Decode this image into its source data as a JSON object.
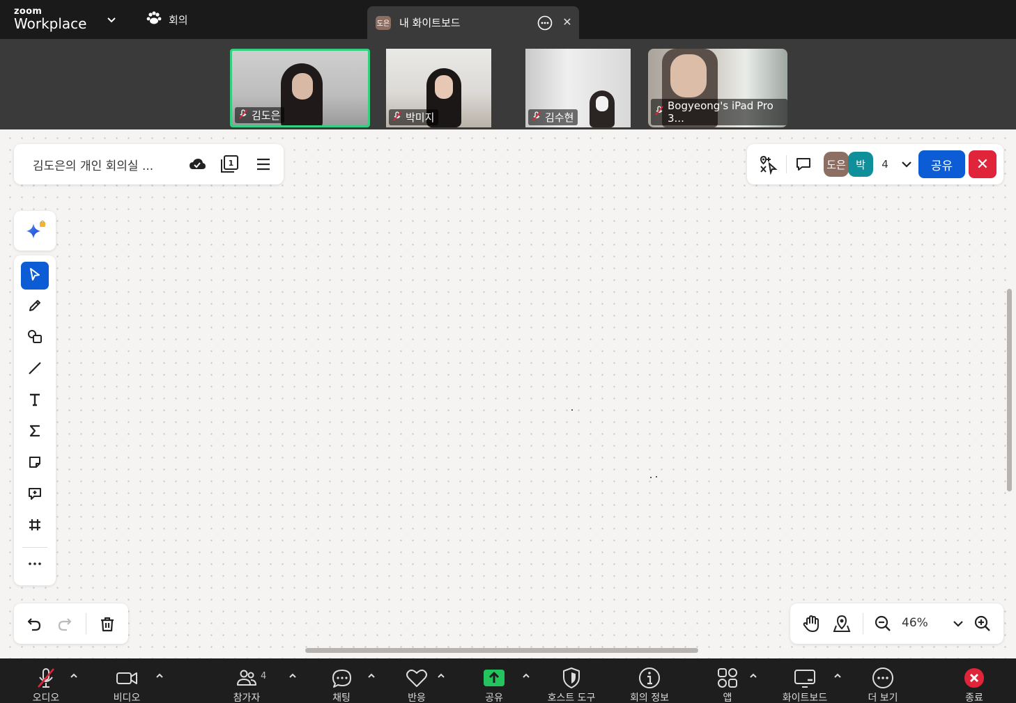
{
  "app": {
    "brand_small": "zoom",
    "brand_big": "Workplace",
    "meeting_tab_label": "회의"
  },
  "whiteboard_tab": {
    "avatar_text": "도은",
    "title": "내 화이트보드"
  },
  "participants": [
    {
      "name": "김도은",
      "muted": true,
      "active": true
    },
    {
      "name": "박미지",
      "muted": true,
      "active": false
    },
    {
      "name": "김수현",
      "muted": true,
      "active": false
    },
    {
      "name": "Bogyeong's iPad Pro 3...",
      "muted": true,
      "active": false
    }
  ],
  "board": {
    "title": "김도은의 개인 회의실 ...",
    "page_badge": "1",
    "collaborators": [
      {
        "initials": "도은",
        "color": "#8d6e63"
      },
      {
        "initials": "박",
        "color": "#0e8f9a"
      }
    ],
    "collaborator_count": "4",
    "share_label": "공유",
    "zoom_level": "46%"
  },
  "tools": [
    {
      "name": "select-tool",
      "icon": "cursor-icon"
    },
    {
      "name": "pen-tool",
      "icon": "pen-icon"
    },
    {
      "name": "shapes-tool",
      "icon": "shapes-icon"
    },
    {
      "name": "line-tool",
      "icon": "line-icon"
    },
    {
      "name": "text-tool",
      "icon": "text-icon"
    },
    {
      "name": "math-tool",
      "icon": "sigma-icon"
    },
    {
      "name": "sticky-note-tool",
      "icon": "sticky-note-icon"
    },
    {
      "name": "comment-tool",
      "icon": "comment-icon"
    },
    {
      "name": "frame-tool",
      "icon": "frame-icon"
    },
    {
      "name": "more-tools",
      "icon": "ellipsis-icon"
    }
  ],
  "toolbar": {
    "audio": "오디오",
    "video": "비디오",
    "participants": "참가자",
    "participants_count": "4",
    "chat": "채팅",
    "reactions": "반응",
    "share": "공유",
    "host_tools": "호스트 도구",
    "meeting_info": "회의 정보",
    "apps": "앱",
    "whiteboard": "화이트보드",
    "more": "더 보기",
    "end": "종료"
  },
  "colors": {
    "accent": "#0b5cd5",
    "danger": "#e0243a",
    "active_speaker": "#35d07f",
    "share_green": "#23c45e"
  }
}
